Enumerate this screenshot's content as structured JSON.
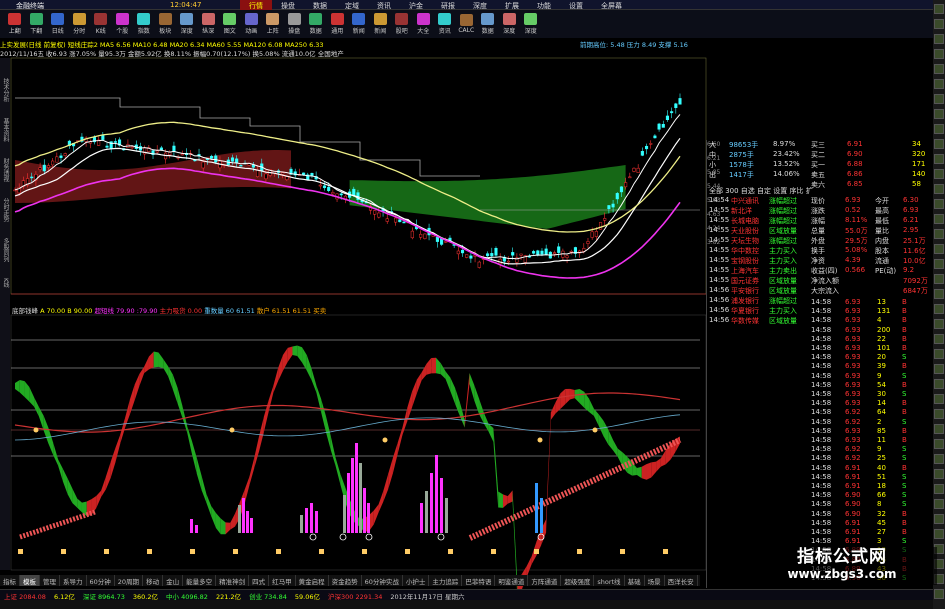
{
  "window": {
    "app_title": "金融终端",
    "clock": "12:04:47"
  },
  "menu": [
    "行情",
    "操盘",
    "数据",
    "定域",
    "资讯",
    "沪金",
    "研报",
    "深度",
    "扩展",
    "功能",
    "设置",
    "全屏幕"
  ],
  "toolbar": [
    "上翻",
    "下翻",
    "日线",
    "分时",
    "K线",
    "个股",
    "指数",
    "板块",
    "深度",
    "纵深",
    "图文",
    "动画",
    "上阵",
    "操盘",
    "数据",
    "通用",
    "新闻",
    "新闻",
    "股吧",
    "大全",
    "资讯",
    "CALC",
    "数据",
    "深度",
    "深度"
  ],
  "chart_header": {
    "line1": "上实发展(日线 前复权) 短线庄踪2  MA5 6.56 MA10 6.48 MA20 6.34 MA60 5.55 MA120 6.08 MA250 6.33",
    "line2": "2012/11/16五 收6.93 涨7.05% 量95.3万 金额5.92亿 换8.11% 振幅0.70(12.17%) 换5.08% 流通10.0亿 全国地产",
    "right": "前期高位: 5.48  压力 8.49  支撑 5.16"
  },
  "left_tabs": [
    "技术分析",
    "基本资料",
    "财务透视",
    "分时走势",
    "多股同列",
    "K线"
  ],
  "indicator_header": {
    "name": "底部钱峰",
    "a": "A 70.00 B 90.00",
    "short": "超短线 79.90 :79.90",
    "main": "主力吸货 0.00",
    "big": "重数量 60 61.51",
    "retail": "散户 61.51 61.51 买卖"
  },
  "bottom_tabs": [
    "指标",
    "模板",
    "管理",
    "系导力",
    "60分钟",
    "20周期",
    "移动",
    "金山",
    "能量多空",
    "精准神剑",
    "四式",
    "红马甲",
    "黄金启程",
    "资金趋势",
    "60分钟实战",
    "小护士",
    "主力追踪",
    "巴菲特语",
    "明鉴通道",
    "方阵通道",
    "超级强度",
    "short线",
    "基础",
    "场景",
    "西洋长安"
  ],
  "status_bar": [
    {
      "text": "上证 2084.08",
      "color": "#f33"
    },
    {
      "text": "6.12亿",
      "color": "#ff0"
    },
    {
      "text": "深证 8964.73",
      "color": "#3f3"
    },
    {
      "text": "360.2亿",
      "color": "#ff0"
    },
    {
      "text": "中小 4096.82",
      "color": "#3f3"
    },
    {
      "text": "221.2亿",
      "color": "#ff0"
    },
    {
      "text": "创业 734.84",
      "color": "#3f3"
    },
    {
      "text": "59.06亿",
      "color": "#ff0"
    },
    {
      "text": "沪深300 2291.34",
      "color": "#f33"
    },
    {
      "text": "2012年11月17日 星期六",
      "color": "#ccc"
    }
  ],
  "right_panel": {
    "flows": [
      {
        "label": "大",
        "value": "98653手",
        "pct": "8.97%"
      },
      {
        "label": "中",
        "value": "2875手",
        "pct": "23.42%"
      },
      {
        "label": "小",
        "value": "1578手",
        "pct": "13.52%"
      },
      {
        "label": "出",
        "value": "1417手",
        "pct": "14.06%"
      }
    ],
    "order_book": [
      {
        "label": "买三",
        "price": "6.91",
        "vol": "34"
      },
      {
        "label": "买二",
        "price": "6.90",
        "vol": "320"
      },
      {
        "label": "买一",
        "price": "6.88",
        "vol": "171"
      },
      {
        "label": "卖五",
        "price": "6.86",
        "vol": "140"
      },
      {
        "label": "卖六",
        "price": "6.85",
        "vol": "58"
      }
    ],
    "tabs": "全部 300 自选 自定 设置 序比 扩",
    "stats": [
      {
        "k1": "现价",
        "v1": "6.93",
        "k2": "今开",
        "v2": "6.30"
      },
      {
        "k1": "涨跌",
        "v1": "0.52",
        "k2": "最高",
        "v2": "6.93"
      },
      {
        "k1": "涨幅",
        "v1": "8.11%",
        "k2": "最低",
        "v2": "6.21"
      },
      {
        "k1": "总量",
        "v1": "55.0万",
        "k2": "量比",
        "v2": "2.95"
      },
      {
        "k1": "外盘",
        "v1": "29.5万",
        "k2": "内盘",
        "v2": "25.1万"
      },
      {
        "k1": "换手",
        "v1": "5.08%",
        "k2": "股本",
        "v2": "11.6亿"
      },
      {
        "k1": "净资",
        "v1": "4.39",
        "k2": "流通",
        "v2": "10.0亿"
      },
      {
        "k1": "收益(四)",
        "v1": "0.566",
        "k2": "PE(动)",
        "v2": "9.2"
      },
      {
        "k1": "净流入额",
        "v1": "",
        "k2": "",
        "v2": "7092万"
      },
      {
        "k1": "大宗流入",
        "v1": "",
        "k2": "",
        "v2": "6847万"
      }
    ],
    "news": [
      {
        "time": "14:54",
        "name": "中兴通讯",
        "desc": "涨幅超过"
      },
      {
        "time": "14:55",
        "name": "新北洋",
        "desc": "涨幅超过"
      },
      {
        "time": "14:55",
        "name": "长城电脑",
        "desc": "涨幅超过"
      },
      {
        "time": "14:55",
        "name": "天业股份",
        "desc": "区域放量"
      },
      {
        "time": "14:55",
        "name": "天坛生物",
        "desc": "涨幅超过"
      },
      {
        "time": "14:55",
        "name": "华中数控",
        "desc": "主力买入"
      },
      {
        "time": "14:55",
        "name": "宝钢股份",
        "desc": "主力买入"
      },
      {
        "time": "14:55",
        "name": "上海汽车",
        "desc": "主力卖出"
      },
      {
        "time": "14:55",
        "name": "国元证券",
        "desc": "区域放量"
      },
      {
        "time": "14:56",
        "name": "平安银行",
        "desc": "区域放量"
      },
      {
        "time": "14:56",
        "name": "浦发银行",
        "desc": "涨幅超过"
      },
      {
        "time": "14:56",
        "name": "华夏银行",
        "desc": "主力买入"
      },
      {
        "time": "14:56",
        "name": "华数传媒",
        "desc": "区域放量"
      }
    ],
    "ticks": [
      {
        "time": "14:58",
        "price": "6.93",
        "vol": "13",
        "dir": "B"
      },
      {
        "time": "14:58",
        "price": "6.93",
        "vol": "131",
        "dir": "B"
      },
      {
        "time": "14:58",
        "price": "6.93",
        "vol": "4",
        "dir": "B"
      },
      {
        "time": "14:58",
        "price": "6.93",
        "vol": "200",
        "dir": "B"
      },
      {
        "time": "14:58",
        "price": "6.93",
        "vol": "22",
        "dir": "B"
      },
      {
        "time": "14:58",
        "price": "6.93",
        "vol": "101",
        "dir": "B"
      },
      {
        "time": "14:58",
        "price": "6.93",
        "vol": "20",
        "dir": "S"
      },
      {
        "time": "14:58",
        "price": "6.93",
        "vol": "39",
        "dir": "B"
      },
      {
        "time": "14:58",
        "price": "6.93",
        "vol": "9",
        "dir": "S"
      },
      {
        "time": "14:58",
        "price": "6.93",
        "vol": "54",
        "dir": "B"
      },
      {
        "time": "14:58",
        "price": "6.93",
        "vol": "30",
        "dir": "S"
      },
      {
        "time": "14:58",
        "price": "6.93",
        "vol": "14",
        "dir": "B"
      },
      {
        "time": "14:58",
        "price": "6.92",
        "vol": "64",
        "dir": "B"
      },
      {
        "time": "14:58",
        "price": "6.92",
        "vol": "2",
        "dir": "S"
      },
      {
        "time": "14:58",
        "price": "6.93",
        "vol": "85",
        "dir": "B"
      },
      {
        "time": "14:58",
        "price": "6.93",
        "vol": "11",
        "dir": "B"
      },
      {
        "time": "14:58",
        "price": "6.92",
        "vol": "9",
        "dir": "S"
      },
      {
        "time": "14:58",
        "price": "6.92",
        "vol": "25",
        "dir": "S"
      },
      {
        "time": "14:58",
        "price": "6.91",
        "vol": "40",
        "dir": "B"
      },
      {
        "time": "14:58",
        "price": "6.91",
        "vol": "51",
        "dir": "S"
      },
      {
        "time": "14:58",
        "price": "6.91",
        "vol": "18",
        "dir": "S"
      },
      {
        "time": "14:58",
        "price": "6.90",
        "vol": "66",
        "dir": "S"
      },
      {
        "time": "14:58",
        "price": "6.90",
        "vol": "8",
        "dir": "S"
      },
      {
        "time": "14:58",
        "price": "6.90",
        "vol": "32",
        "dir": "B"
      },
      {
        "time": "14:58",
        "price": "6.91",
        "vol": "45",
        "dir": "B"
      },
      {
        "time": "14:58",
        "price": "6.91",
        "vol": "27",
        "dir": "B"
      },
      {
        "time": "14:58",
        "price": "6.91",
        "vol": "3",
        "dir": "S"
      },
      {
        "time": "14:58",
        "price": "6.89",
        "vol": "19",
        "dir": "S"
      },
      {
        "time": "14:58",
        "price": "6.89",
        "vol": "16",
        "dir": "B"
      },
      {
        "time": "14:58",
        "price": "6.89",
        "vol": "43",
        "dir": "B"
      },
      {
        "time": "14:58",
        "price": "6.90",
        "vol": "56",
        "dir": "S"
      },
      {
        "time": "14:58",
        "price": "6.90",
        "vol": "21",
        "dir": "B"
      },
      {
        "time": "14:58",
        "price": "6.90",
        "vol": "14",
        "dir": "B"
      }
    ]
  },
  "right_axis": [
    "6.60",
    "6.21",
    "5.85",
    "5.44",
    "5.03",
    "4.63",
    "4.24",
    "3.82"
  ],
  "watermark": {
    "cn": "指标公式网",
    "url": "www.zbgs3.com"
  },
  "colors": {
    "up": "#f33",
    "down": "#3f3",
    "price": "#ff0",
    "volume": "#f3f",
    "accent": "#8a1010"
  }
}
